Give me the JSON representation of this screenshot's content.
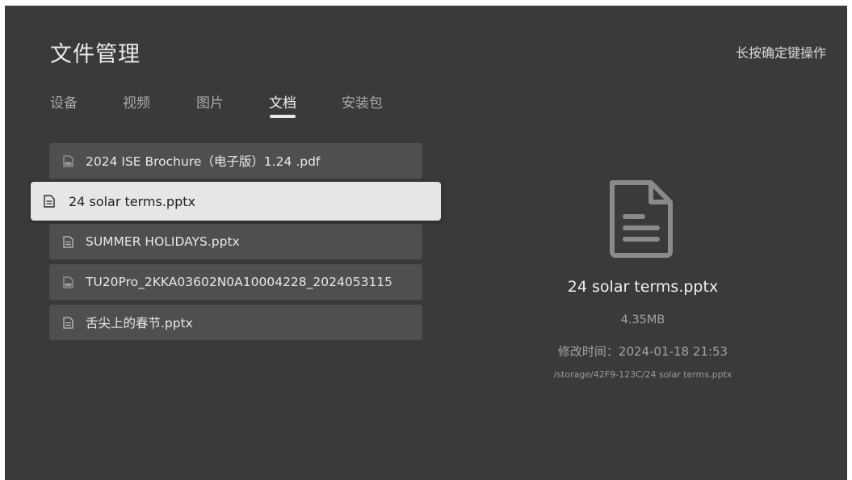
{
  "app": {
    "title": "文件管理",
    "hint": "长按确定键操作"
  },
  "tabs": [
    {
      "label": "设备",
      "active": false
    },
    {
      "label": "视频",
      "active": false
    },
    {
      "label": "图片",
      "active": false
    },
    {
      "label": "文档",
      "active": true
    },
    {
      "label": "安装包",
      "active": false
    }
  ],
  "files": [
    {
      "name": "2024 ISE Brochure（电子版）1.24 .pdf",
      "icon": "pdf-file-icon",
      "selected": false
    },
    {
      "name": "24 solar terms.pptx",
      "icon": "document-icon",
      "selected": true
    },
    {
      "name": "SUMMER HOLIDAYS.pptx",
      "icon": "document-icon",
      "selected": false
    },
    {
      "name": "TU20Pro_2KKA03602N0A10004228_2024053115",
      "icon": "pdf-file-icon",
      "selected": false
    },
    {
      "name": "舌尖上的春节.pptx",
      "icon": "document-icon",
      "selected": false
    }
  ],
  "preview": {
    "icon": "document-icon",
    "name": "24 solar terms.pptx",
    "size": "4.35MB",
    "modified_label": "修改时间：",
    "modified_value": "2024-01-18 21:53",
    "path": "/storage/42F9-123C/24 solar terms.pptx"
  },
  "colors": {
    "background": "#3a3a3a",
    "row": "#4f4f4f",
    "selected_row": "#e6e6e6",
    "text_primary": "#e8e8e8",
    "text_secondary": "#a3a3a3"
  }
}
